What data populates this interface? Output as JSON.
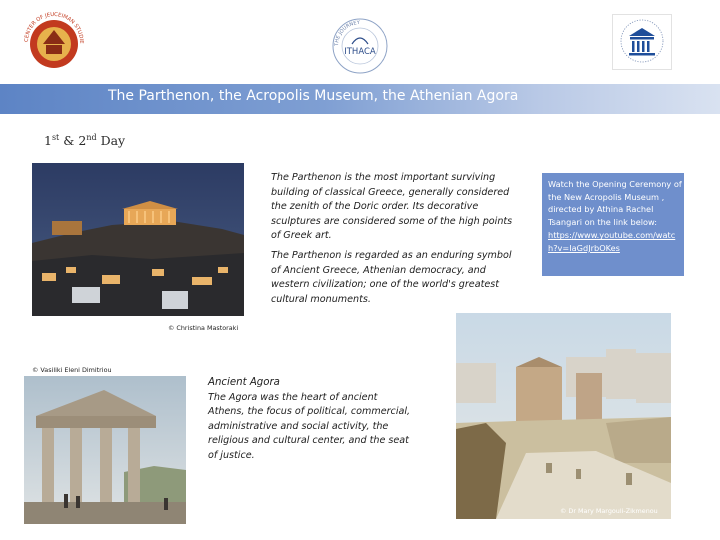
{
  "logos": {
    "left": {
      "icon": "circular-emblem-icon",
      "text": "CENTER OF JEUCEIMAN STUDIES"
    },
    "middle": {
      "icon": "ithaca-seal-icon",
      "text": "ITHACA",
      "ring_text": "THE JOURNEY"
    },
    "right": {
      "icon": "unesco-temple-icon"
    }
  },
  "header": {
    "title": "The Parthenon, the Acropolis Museum, the Athenian Agora"
  },
  "day_label": {
    "prefix": "1",
    "sup1": "st",
    "mid": " & 2",
    "sup2": "nd",
    "suffix": " Day"
  },
  "parthenon": {
    "credit": "© Christina Mastoraki",
    "paragraph1": "The Parthenon is the most important surviving building of classical Greece, generally considered the zenith of the Doric order. Its decorative sculptures are considered some of the high points of Greek art.",
    "paragraph2": "The Parthenon is regarded as an enduring symbol of Ancient Greece, Athenian democracy, and western civilization; one of the world's greatest cultural monuments."
  },
  "video": {
    "text": "Watch the Opening Ceremony of the New Acropolis Museum , directed by Athina Rachel Tsangari on the link below:",
    "link": "https://www.youtube.com/watch?v=IaGdJrbOKes"
  },
  "gate_photo": {
    "credit": "© Vasiliki Eleni Dimitriou"
  },
  "agora": {
    "heading": "Ancient Agora",
    "body": "The Agora was the heart of ancient Athens, the focus of political, commercial, administrative and social activity, the religious and cultural center, and the seat of justice.",
    "credit": "© Dr Mary Margouli-Zikmenou"
  },
  "colors": {
    "band_start": "#5d84c5",
    "band_end": "#d9e2f1",
    "video_box": "#6f8fcc"
  }
}
